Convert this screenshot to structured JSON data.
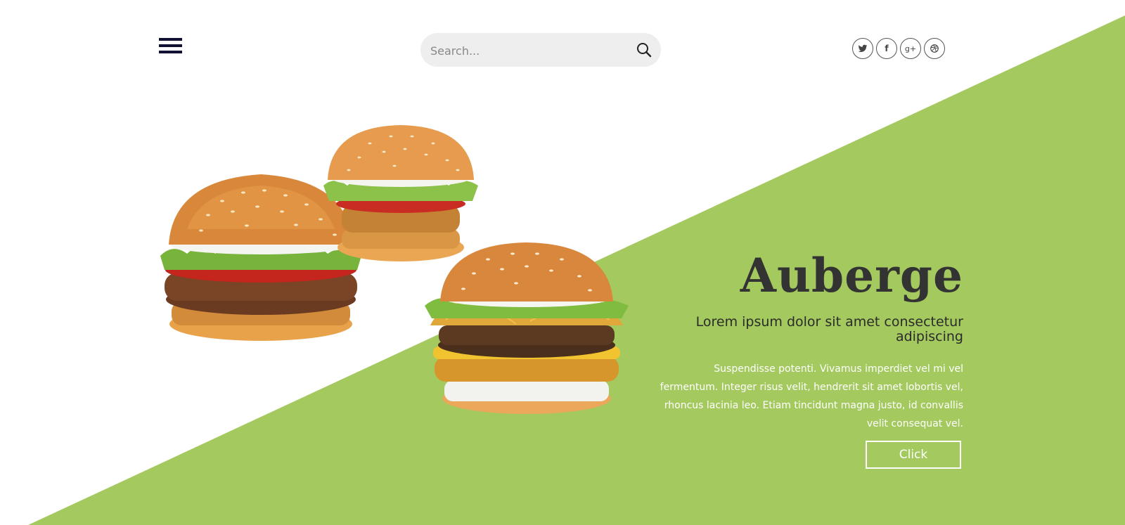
{
  "header": {
    "menu_icon": "hamburger-menu-icon",
    "search": {
      "placeholder": "Search...",
      "icon": "search-icon"
    },
    "social": [
      {
        "name": "twitter",
        "icon": "twitter-icon"
      },
      {
        "name": "facebook",
        "icon": "facebook-icon",
        "glyph": "f"
      },
      {
        "name": "google-plus",
        "icon": "google-plus-icon",
        "glyph": "g+"
      },
      {
        "name": "dribbble",
        "icon": "dribbble-icon"
      }
    ]
  },
  "hero": {
    "title": "Auberge",
    "subtitle": "Lorem ipsum dolor sit amet consectetur adipiscing",
    "body": "Suspendisse potenti. Vivamus imperdiet vel mi vel fermentum. Integer risus velit, hendrerit sit amet lobortis vel, rhoncus lacinia leo. Etiam tincidunt magna justo, id convallis velit consequat vel.",
    "cta_label": "Click"
  },
  "colors": {
    "accent": "#a4c95f",
    "menu": "#111133",
    "text_dark": "#333333",
    "white": "#ffffff",
    "search_bg": "#eeeeee"
  }
}
